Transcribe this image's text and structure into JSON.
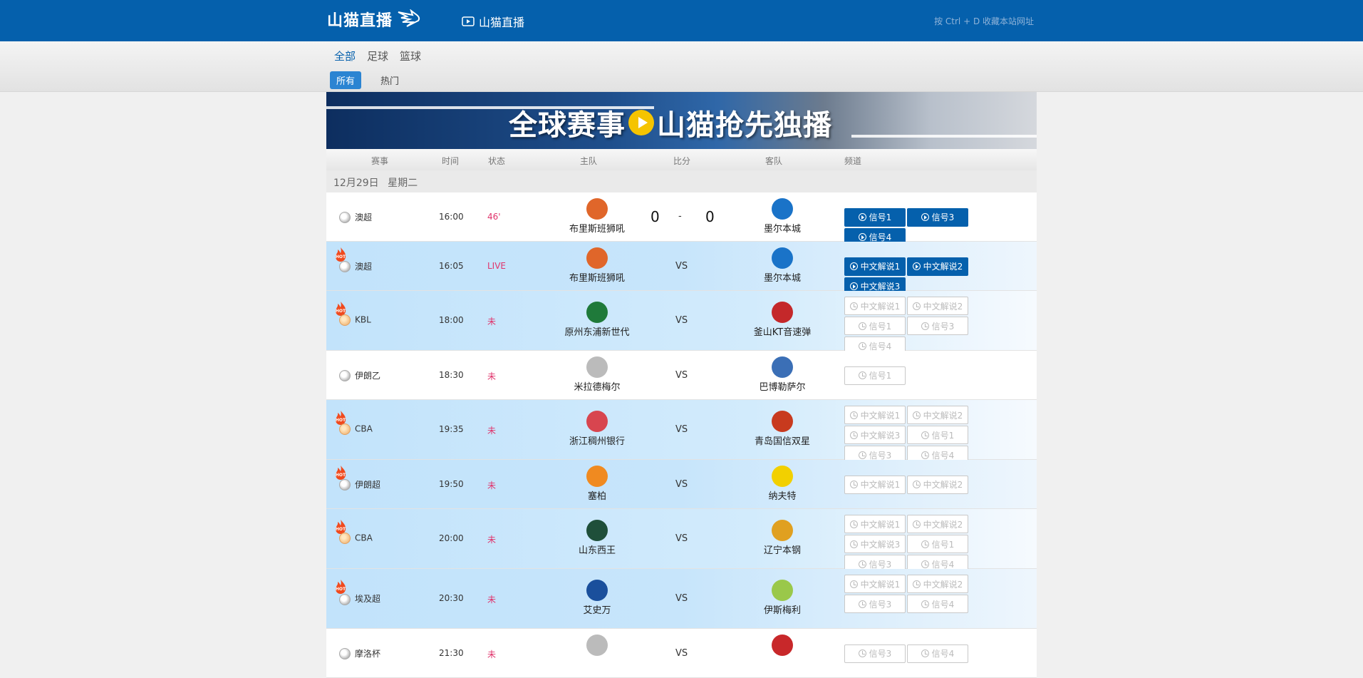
{
  "header": {
    "logo_text": "山猫直播",
    "live_link": "山猫直播",
    "bookmark_hint": "按 Ctrl + D 收藏本站网址"
  },
  "nav": {
    "tabs": [
      "全部",
      "足球",
      "篮球"
    ],
    "active_tab": "全部",
    "filters": [
      "所有",
      "热门"
    ],
    "active_filter": "所有"
  },
  "banner": {
    "left_text": "全球赛事",
    "right_text": "山猫抢先独播"
  },
  "columns": {
    "event": "赛事",
    "time": "时间",
    "status": "状态",
    "home": "主队",
    "score": "比分",
    "away": "客队",
    "channel": "频道"
  },
  "date": {
    "day": "12月29日",
    "weekday": "星期二"
  },
  "matches": [
    {
      "league": "澳超",
      "sport": "football",
      "hot": false,
      "time": "16:00",
      "status": "46'",
      "home": "布里斯班狮吼",
      "away": "墨尔本城",
      "home_score": "0",
      "sep": "-",
      "away_score": "0",
      "buttons": [
        "信号1",
        "信号3",
        "信号4"
      ],
      "active": true
    },
    {
      "league": "澳超",
      "sport": "football",
      "hot": true,
      "time": "16:05",
      "status": "LIVE",
      "home": "布里斯班狮吼",
      "away": "墨尔本城",
      "vs": "VS",
      "buttons": [
        "中文解说1",
        "中文解说2",
        "中文解说3"
      ],
      "active": true
    },
    {
      "league": "KBL",
      "sport": "basketball",
      "hot": true,
      "time": "18:00",
      "status": "未",
      "home": "原州东浦新世代",
      "away": "釜山KT音速弹",
      "vs": "VS",
      "buttons": [
        "中文解说1",
        "中文解说2",
        "信号1",
        "信号3",
        "信号4"
      ],
      "active": false
    },
    {
      "league": "伊朗乙",
      "sport": "football",
      "hot": false,
      "time": "18:30",
      "status": "未",
      "home": "米拉德梅尔",
      "away": "巴博勒萨尔",
      "vs": "VS",
      "buttons": [
        "信号1"
      ],
      "active": false
    },
    {
      "league": "CBA",
      "sport": "basketball",
      "hot": true,
      "time": "19:35",
      "status": "未",
      "home": "浙江稠州银行",
      "away": "青岛国信双星",
      "vs": "VS",
      "buttons": [
        "中文解说1",
        "中文解说2",
        "中文解说3",
        "信号1",
        "信号3",
        "信号4"
      ],
      "active": false
    },
    {
      "league": "伊朗超",
      "sport": "football",
      "hot": true,
      "time": "19:50",
      "status": "未",
      "home": "塞柏",
      "away": "纳夫特",
      "vs": "VS",
      "buttons": [
        "中文解说1",
        "中文解说2"
      ],
      "active": false
    },
    {
      "league": "CBA",
      "sport": "basketball",
      "hot": true,
      "time": "20:00",
      "status": "未",
      "home": "山东西王",
      "away": "辽宁本钢",
      "vs": "VS",
      "buttons": [
        "中文解说1",
        "中文解说2",
        "中文解说3",
        "信号1",
        "信号3",
        "信号4"
      ],
      "active": false
    },
    {
      "league": "埃及超",
      "sport": "football",
      "hot": true,
      "time": "20:30",
      "status": "未",
      "home": "艾史万",
      "away": "伊斯梅利",
      "vs": "VS",
      "buttons": [
        "中文解说1",
        "中文解说2",
        "信号3",
        "信号4"
      ],
      "active": false
    },
    {
      "league": "摩洛杯",
      "sport": "football",
      "hot": false,
      "time": "21:30",
      "status": "未",
      "home": "",
      "away": "",
      "vs": "VS",
      "buttons": [
        "信号3",
        "信号4"
      ],
      "active": false
    }
  ],
  "colors": {
    "brand": "#0560ac",
    "status": "#e0346c",
    "hot_row": "#c2e3fb"
  }
}
